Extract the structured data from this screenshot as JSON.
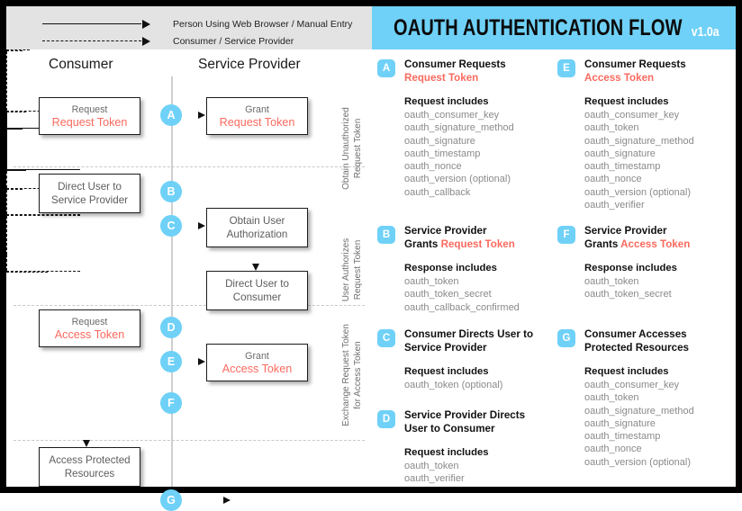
{
  "legend": {
    "rows": [
      {
        "style": "solid",
        "label": "Person Using Web Browser / Manual Entry"
      },
      {
        "style": "dashed",
        "label": "Consumer / Service Provider"
      }
    ]
  },
  "banner": {
    "title": "OAUTH AUTHENTICATION FLOW",
    "version": "v1.0a",
    "bg": "#6fd1f7"
  },
  "colors": {
    "accent": "#6fd1f7",
    "red": "#fa6a5f",
    "gray_text": "#6a6a6a",
    "legend_bg": "#e3e3e3"
  },
  "diagram": {
    "columns": [
      {
        "label": "Consumer"
      },
      {
        "label": "Service Provider"
      }
    ],
    "phases": [
      {
        "label": "Obtain Unauthorized\nRequest Token",
        "line1": "Obtain Unauthorized",
        "line2": "Request Token"
      },
      {
        "label": "User Authorizes\nRequest Token",
        "line1": "User Authorizes",
        "line2": "Request Token"
      },
      {
        "label": "Exchange Request Token\nfor Access Token",
        "line1": "Exchange Request Token",
        "line2": "for Access Token"
      }
    ],
    "nodes": [
      {
        "id": "n1",
        "line1": "Request",
        "line2": "Request Token"
      },
      {
        "id": "n2",
        "line1": "Grant",
        "line2": "Request Token"
      },
      {
        "id": "n3",
        "line1": "Direct User to",
        "line2": "Service Provider",
        "plain": true
      },
      {
        "id": "n4",
        "line1": "Obtain User",
        "line2": "Authorization",
        "plain": true
      },
      {
        "id": "n5",
        "line1": "Direct User to",
        "line2": "Consumer",
        "plain": true
      },
      {
        "id": "n6",
        "line1": "Request",
        "line2": "Access Token"
      },
      {
        "id": "n7",
        "line1": "Grant",
        "line2": "Access Token"
      },
      {
        "id": "n8",
        "line1": "Access Protected",
        "line2": "Resources",
        "plain": true
      }
    ],
    "badges": [
      "A",
      "B",
      "C",
      "D",
      "E",
      "F",
      "G"
    ]
  },
  "panel": {
    "sections": [
      {
        "key": "A",
        "head_line1": "Consumer Requests",
        "head_line2": "Request Token",
        "head_line2_red": true,
        "sub": "Request includes",
        "params": [
          "oauth_consumer_key",
          "oauth_signature_method",
          "oauth_signature",
          "oauth_timestamp",
          "oauth_nonce",
          "oauth_version (optional)",
          "oauth_callback"
        ]
      },
      {
        "key": "E",
        "head_line1": "Consumer Requests",
        "head_line2": "Access Token",
        "head_line2_red": true,
        "sub": "Request includes",
        "params": [
          "oauth_consumer_key",
          "oauth_token",
          "oauth_signature_method",
          "oauth_signature",
          "oauth_timestamp",
          "oauth_nonce",
          "oauth_version (optional)",
          "oauth_verifier"
        ]
      },
      {
        "key": "B",
        "head_line1": "Service Provider",
        "head_line2_black": "Grants ",
        "head_line2": "Request Token",
        "head_line2_red": true,
        "sub": "Response includes",
        "params": [
          "oauth_token",
          "oauth_token_secret",
          "oauth_callback_confirmed"
        ]
      },
      {
        "key": "F",
        "head_line1": "Service Provider",
        "head_line2_black": "Grants ",
        "head_line2": "Access Token",
        "head_line2_red": true,
        "sub": "Response includes",
        "params": [
          "oauth_token",
          "oauth_token_secret"
        ]
      },
      {
        "key": "C",
        "head_line1": "Consumer Directs User to",
        "head_line2": "Service Provider",
        "head_line2_red": false,
        "sub": "Request includes",
        "params": [
          "oauth_token (optional)"
        ]
      },
      {
        "key": "G",
        "head_line1": "Consumer Accesses",
        "head_line2": "Protected Resources",
        "head_line2_red": false,
        "sub": "Request includes",
        "params": [
          "oauth_consumer_key",
          "oauth_token",
          "oauth_signature_method",
          "oauth_signature",
          "oauth_timestamp",
          "oauth_nonce",
          "oauth_version (optional)"
        ]
      },
      {
        "key": "D",
        "head_line1": "Service Provider Directs",
        "head_line2": "User to Consumer",
        "head_line2_red": false,
        "sub": "Request includes",
        "params": [
          "oauth_token",
          "oauth_verifier"
        ]
      }
    ]
  }
}
